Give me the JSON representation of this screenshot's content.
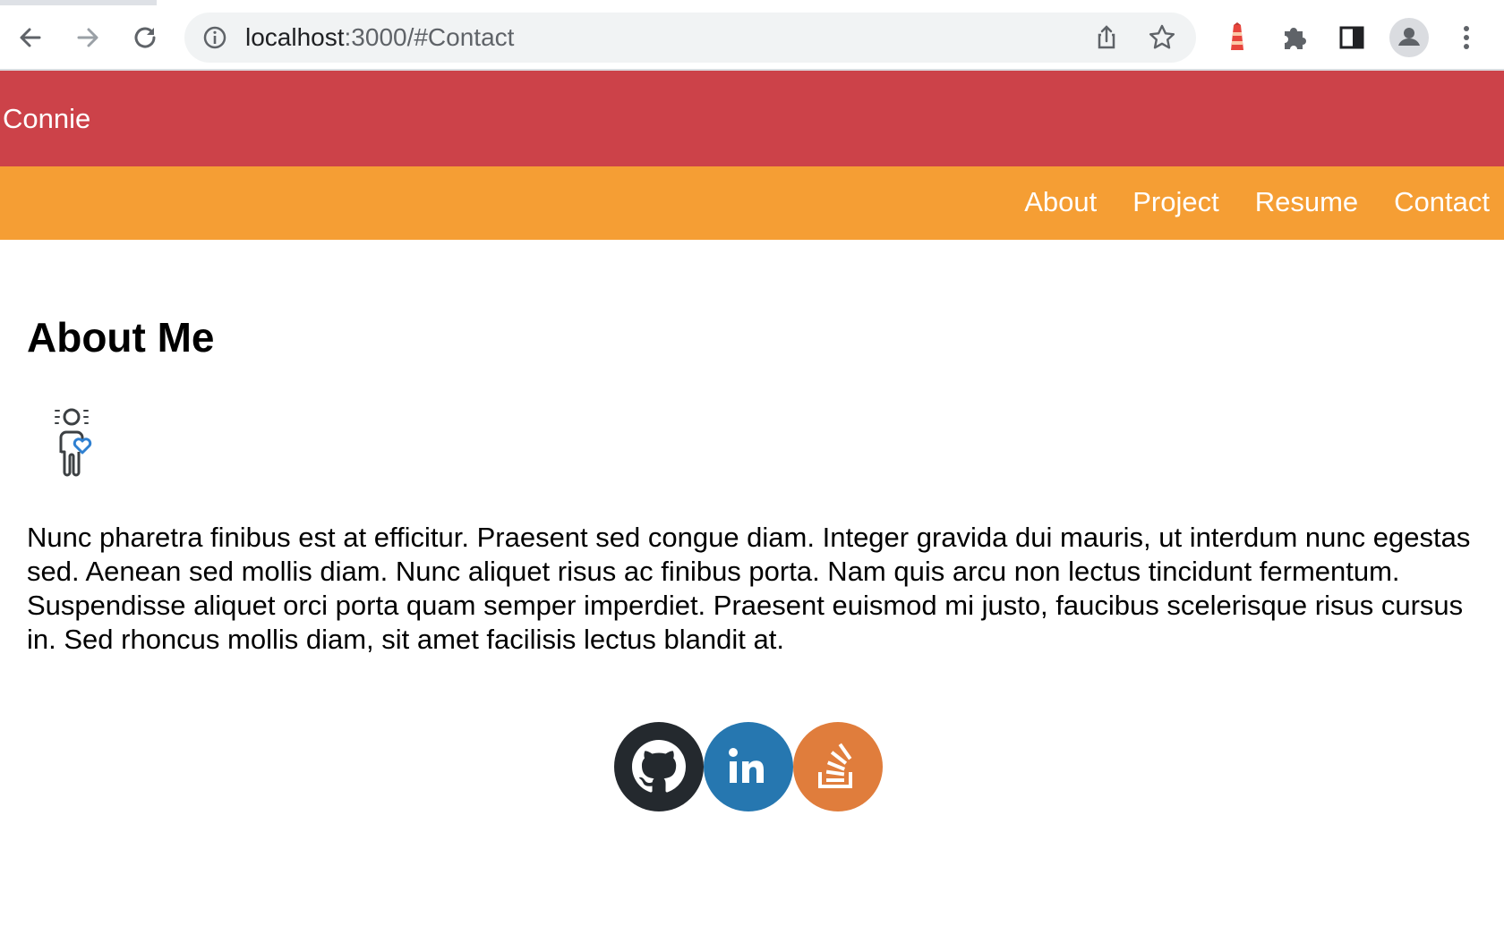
{
  "browser": {
    "url_host": "localhost",
    "url_rest": ":3000/#Contact"
  },
  "site": {
    "brand": "Connie",
    "nav": [
      "About",
      "Project",
      "Resume",
      "Contact"
    ]
  },
  "main": {
    "title": "About Me",
    "avatar_icon": "person-heart-icon",
    "bio": "Nunc pharetra finibus est at efficitur. Praesent sed congue diam. Integer gravida dui mauris, ut interdum nunc egestas sed. Aenean sed mollis diam. Nunc aliquet risus ac finibus porta. Nam quis arcu non lectus tincidunt fermentum. Suspendisse aliquet orci porta quam semper imperdiet. Praesent euismod mi justo, faucibus scelerisque risus cursus in. Sed rhoncus mollis diam, sit amet facilisis lectus blandit at."
  },
  "social": [
    {
      "icon": "github-icon",
      "color": "#24292e"
    },
    {
      "icon": "linkedin-icon",
      "color": "#2677b0",
      "text": "in"
    },
    {
      "icon": "stackoverflow-icon",
      "color": "#e07d3c"
    }
  ],
  "colors": {
    "header": "#cc4249",
    "nav": "#f59e34"
  }
}
